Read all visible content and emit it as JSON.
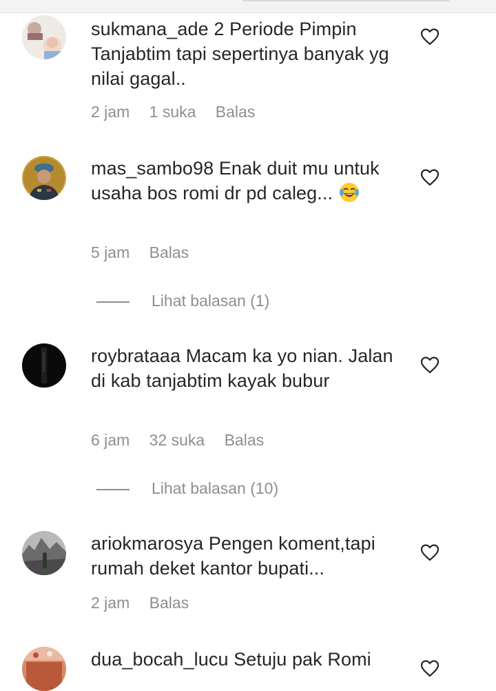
{
  "comments": [
    {
      "username": "sukmana_ade",
      "text": "2 Periode Pimpin Tanjabtim tapi sepertinya banyak yg nilai gagal..",
      "time": "2 jam",
      "likes": "1 suka",
      "reply_label": "Balas"
    },
    {
      "username": "mas_sambo98",
      "text": "Enak duit mu untuk usaha bos romi dr pd caleg...",
      "emoji": "face-with-tears-of-joy",
      "time": "5 jam",
      "likes": "",
      "reply_label": "Balas",
      "view_replies": "Lihat balasan (1)"
    },
    {
      "username": "roybrataaa",
      "text": "Macam ka yo nian. Jalan di kab tanjabtim kayak bubur",
      "time": "6 jam",
      "likes": "32 suka",
      "reply_label": "Balas",
      "view_replies": "Lihat balasan (10)"
    },
    {
      "username": "ariokmarosya",
      "text": "Pengen koment,tapi rumah deket kantor bupati...",
      "time": "2 jam",
      "likes": "",
      "reply_label": "Balas"
    },
    {
      "username": "dua_bocah_lucu",
      "text": "Setuju pak Romi"
    }
  ],
  "colors": {
    "text": "#262626",
    "secondary": "#8e8e8e",
    "background": "#ffffff"
  },
  "icons": {
    "like": "heart-outline-icon"
  }
}
